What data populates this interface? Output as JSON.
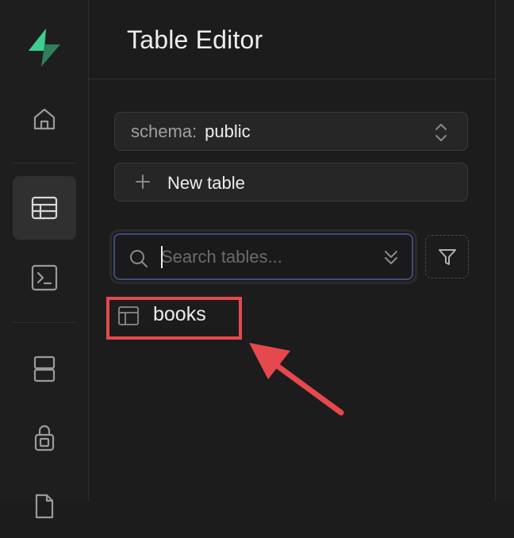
{
  "app": {
    "accent_color": "#3ecf8e"
  },
  "sidebar": {
    "items": [
      {
        "name": "home",
        "icon": "home-icon",
        "active": false
      },
      {
        "name": "table-editor",
        "icon": "table-icon",
        "active": true
      },
      {
        "name": "sql-editor",
        "icon": "terminal-icon",
        "active": false
      },
      {
        "name": "database",
        "icon": "database-icon",
        "active": false
      },
      {
        "name": "authentication",
        "icon": "lock-icon",
        "active": false
      },
      {
        "name": "storage",
        "icon": "file-icon",
        "active": false
      }
    ]
  },
  "panel": {
    "title": "Table Editor",
    "schema": {
      "prefix": "schema:",
      "value": "public"
    },
    "new_table_label": "New table",
    "search": {
      "placeholder": "Search tables...",
      "value": ""
    },
    "tables": [
      {
        "label": "books"
      }
    ]
  },
  "annotation": {
    "highlight_color": "#e5484d"
  }
}
